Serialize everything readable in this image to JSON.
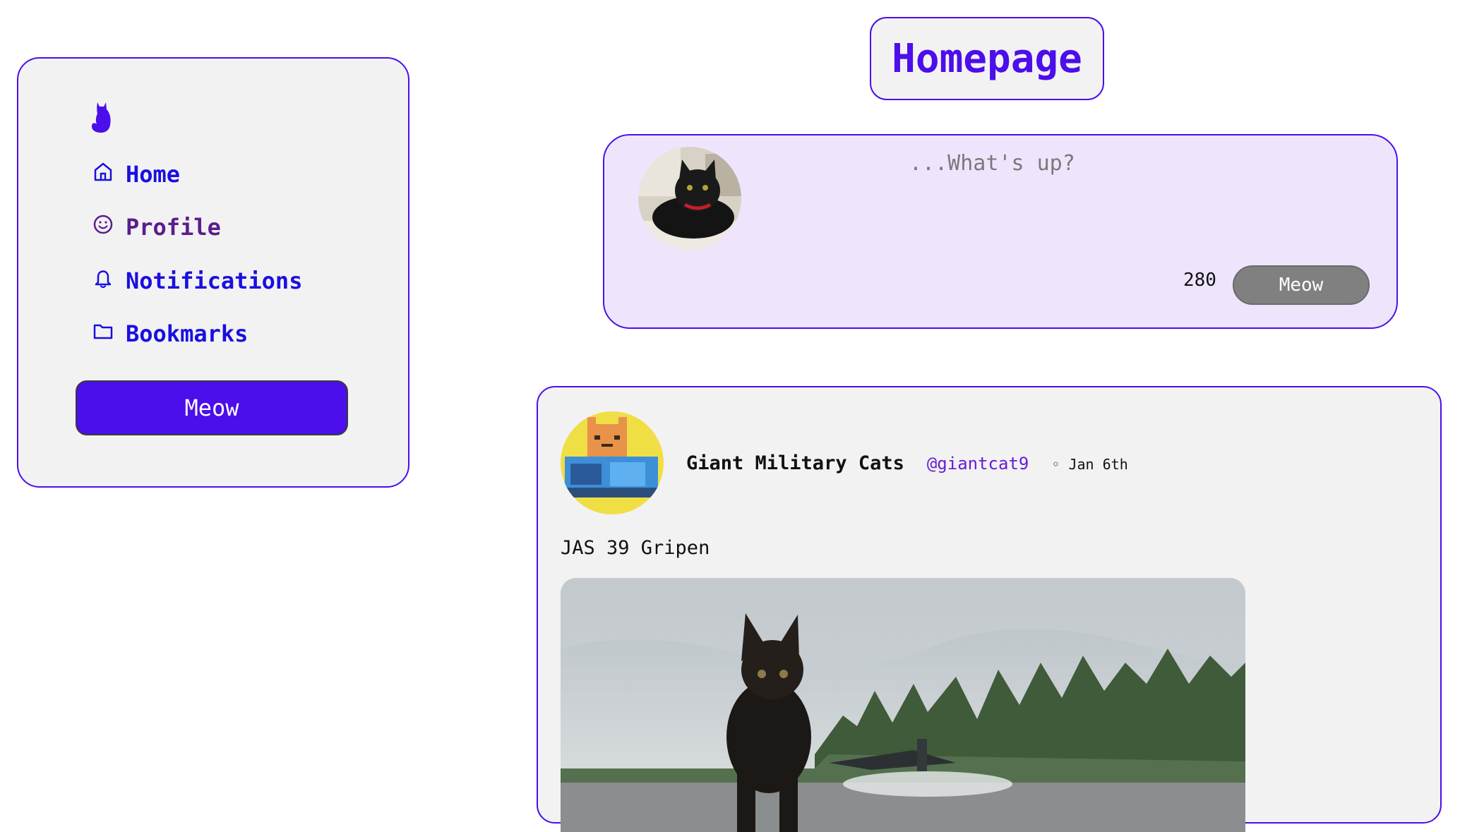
{
  "sidebar": {
    "logo_icon": "cat-icon",
    "items": [
      {
        "label": "Home",
        "icon": "house-icon"
      },
      {
        "label": "Profile",
        "icon": "smiley-icon"
      },
      {
        "label": "Notifications",
        "icon": "bell-icon"
      },
      {
        "label": "Bookmarks",
        "icon": "folder-icon"
      }
    ],
    "button_label": "Meow"
  },
  "header": {
    "title": "Homepage"
  },
  "composer": {
    "placeholder": "...What's up?",
    "char_count": "280",
    "button_label": "Meow"
  },
  "post": {
    "author_name": "Giant Military Cats",
    "handle": "@giantcat9",
    "date": "◦ Jan 6th",
    "text": "JAS 39 Gripen"
  },
  "colors": {
    "accent": "#4c0eea",
    "composer_bg": "#eee5fd",
    "card_bg": "#f2f2f2",
    "disabled_button": "#808080"
  }
}
